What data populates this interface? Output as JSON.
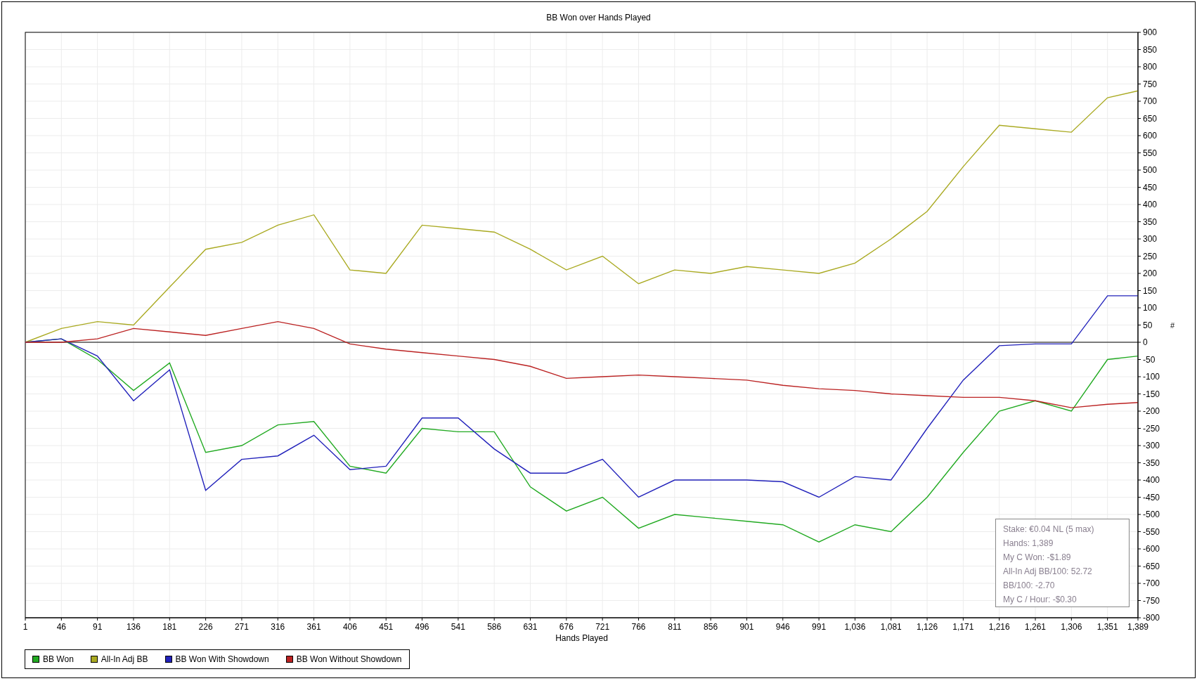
{
  "chart": {
    "chart_data": {
      "type": "line",
      "grid": true,
      "title": "BB Won over Hands Played",
      "xlabel": "Hands Played",
      "ylabel": "#",
      "x": [
        1,
        46,
        91,
        136,
        181,
        226,
        271,
        316,
        361,
        406,
        451,
        496,
        541,
        586,
        631,
        676,
        721,
        766,
        811,
        856,
        901,
        946,
        991,
        1036,
        1081,
        1126,
        1171,
        1216,
        1261,
        1306,
        1351,
        1389
      ],
      "series": [
        {
          "name": "BB Won",
          "color": "#22aa22",
          "values": [
            0,
            10,
            -50,
            -140,
            -60,
            -320,
            -300,
            -240,
            -230,
            -360,
            -380,
            -250,
            -260,
            -260,
            -420,
            -490,
            -450,
            -540,
            -500,
            -510,
            -520,
            -530,
            -580,
            -530,
            -550,
            -450,
            -320,
            -200,
            -170,
            -200,
            -50,
            -40
          ]
        },
        {
          "name": "All-In Adj BB",
          "color": "#aaaa22",
          "values": [
            0,
            40,
            60,
            50,
            160,
            270,
            290,
            340,
            370,
            210,
            200,
            340,
            330,
            320,
            270,
            210,
            250,
            170,
            210,
            200,
            220,
            210,
            200,
            230,
            300,
            380,
            510,
            630,
            620,
            610,
            710,
            730
          ]
        },
        {
          "name": "BB Won With Showdown",
          "color": "#2222bb",
          "values": [
            0,
            10,
            -40,
            -170,
            -80,
            -430,
            -340,
            -330,
            -270,
            -370,
            -360,
            -220,
            -220,
            -310,
            -380,
            -380,
            -340,
            -450,
            -400,
            -400,
            -400,
            -405,
            -450,
            -390,
            -400,
            -250,
            -110,
            -10,
            -5,
            -5,
            135,
            135
          ]
        },
        {
          "name": "BB Won Without Showdown",
          "color": "#bb2222",
          "values": [
            0,
            0,
            10,
            40,
            30,
            20,
            40,
            60,
            40,
            -5,
            -20,
            -30,
            -40,
            -50,
            -70,
            -105,
            -100,
            -95,
            -100,
            -105,
            -110,
            -125,
            -135,
            -140,
            -150,
            -155,
            -160,
            -160,
            -170,
            -190,
            -180,
            -175
          ]
        }
      ],
      "xlim": [
        1,
        1389
      ],
      "ylim": [
        -800,
        900
      ],
      "xticks": [
        {
          "value": 1,
          "label": "1"
        },
        {
          "value": 46,
          "label": "46"
        },
        {
          "value": 91,
          "label": "91"
        },
        {
          "value": 136,
          "label": "136"
        },
        {
          "value": 181,
          "label": "181"
        },
        {
          "value": 226,
          "label": "226"
        },
        {
          "value": 271,
          "label": "271"
        },
        {
          "value": 316,
          "label": "316"
        },
        {
          "value": 361,
          "label": "361"
        },
        {
          "value": 406,
          "label": "406"
        },
        {
          "value": 451,
          "label": "451"
        },
        {
          "value": 496,
          "label": "496"
        },
        {
          "value": 541,
          "label": "541"
        },
        {
          "value": 586,
          "label": "586"
        },
        {
          "value": 631,
          "label": "631"
        },
        {
          "value": 676,
          "label": "676"
        },
        {
          "value": 721,
          "label": "721"
        },
        {
          "value": 766,
          "label": "766"
        },
        {
          "value": 811,
          "label": "811"
        },
        {
          "value": 856,
          "label": "856"
        },
        {
          "value": 901,
          "label": "901"
        },
        {
          "value": 946,
          "label": "946"
        },
        {
          "value": 991,
          "label": "991"
        },
        {
          "value": 1036,
          "label": "1,036"
        },
        {
          "value": 1081,
          "label": "1,081"
        },
        {
          "value": 1126,
          "label": "1,126"
        },
        {
          "value": 1171,
          "label": "1,171"
        },
        {
          "value": 1216,
          "label": "1,216"
        },
        {
          "value": 1261,
          "label": "1,261"
        },
        {
          "value": 1306,
          "label": "1,306"
        },
        {
          "value": 1351,
          "label": "1,351"
        },
        {
          "value": 1389,
          "label": "1,389"
        }
      ],
      "yticks": [
        900,
        850,
        800,
        750,
        700,
        650,
        600,
        550,
        500,
        450,
        400,
        350,
        300,
        250,
        200,
        150,
        100,
        50,
        0,
        -50,
        -100,
        -150,
        -200,
        -250,
        -300,
        -350,
        -400,
        -450,
        -500,
        -550,
        -600,
        -650,
        -700,
        -750,
        -800
      ]
    },
    "stats": [
      "Stake: €0.04 NL (5 max)",
      "Hands: 1,389",
      "My C Won: -$1.89",
      "All-In Adj BB/100: 52.72",
      "BB/100: -2.70",
      "My C / Hour: -$0.30"
    ]
  }
}
